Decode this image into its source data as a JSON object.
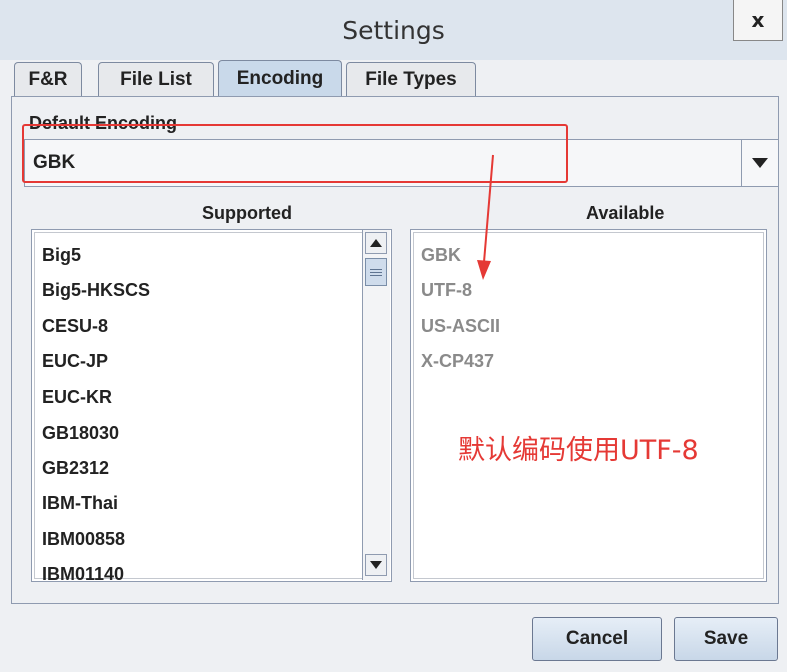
{
  "window": {
    "title": "Settings",
    "close_label": "x"
  },
  "tabs": [
    {
      "label": "F&R",
      "active": false
    },
    {
      "label": "File List",
      "active": false
    },
    {
      "label": "Encoding",
      "active": true
    },
    {
      "label": "File Types",
      "active": false
    }
  ],
  "encoding": {
    "default_label": "Default Encoding",
    "default_value": "GBK",
    "supported_header": "Supported",
    "available_header": "Available",
    "supported": [
      "Big5",
      "Big5-HKSCS",
      "CESU-8",
      "EUC-JP",
      "EUC-KR",
      "GB18030",
      "GB2312",
      "IBM-Thai",
      "IBM00858",
      "IBM01140"
    ],
    "available": [
      "GBK",
      "UTF-8",
      "US-ASCII",
      "X-CP437"
    ]
  },
  "annotation": {
    "text": "默认编码使用UTF-8",
    "color": "#e53935"
  },
  "buttons": {
    "cancel_label": "Cancel",
    "save_label": "Save"
  }
}
